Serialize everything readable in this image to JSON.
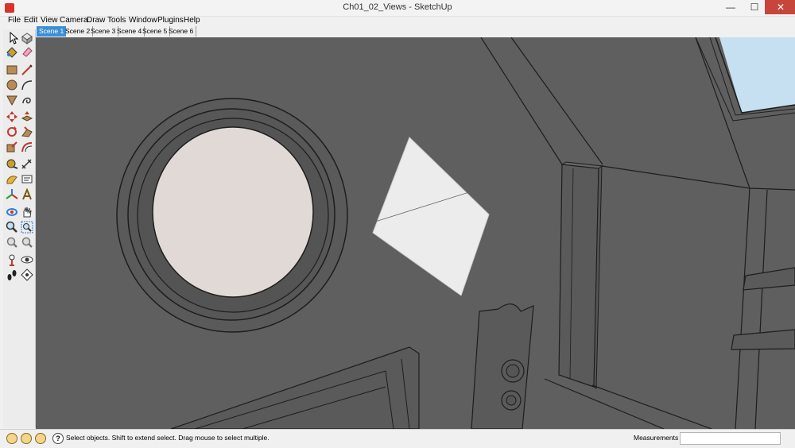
{
  "window": {
    "title": "Ch01_02_Views - SketchUp",
    "minimize": "—",
    "maximize": "☐",
    "close": "✕"
  },
  "menu": [
    "File",
    "Edit",
    "View",
    "Camera",
    "Draw",
    "Tools",
    "Window",
    "Plugins",
    "Help"
  ],
  "scenes": {
    "tabs": [
      "Scene 1",
      "Scene 2",
      "Scene 3",
      "Scene 4",
      "Scene 5",
      "Scene 6"
    ],
    "active": "Scene 1"
  },
  "tools": [
    "select-tool-icon",
    "make-component-icon",
    "paint-bucket-icon",
    "eraser-icon",
    "rectangle-icon",
    "line-icon",
    "circle-icon",
    "arc-icon",
    "polygon-icon",
    "freehand-icon",
    "move-icon",
    "push-pull-icon",
    "rotate-icon",
    "follow-me-icon",
    "scale-icon",
    "offset-icon",
    "tape-measure-icon",
    "dimension-icon",
    "protractor-icon",
    "text-icon",
    "axes-icon",
    "3d-text-icon",
    "orbit-icon",
    "pan-icon",
    "zoom-icon",
    "zoom-window-icon",
    "zoom-extents-icon",
    "previous-view-icon",
    "position-camera-icon",
    "look-around-icon",
    "walk-icon",
    "section-plane-icon"
  ],
  "status": {
    "message": "Select objects. Shift to extend select. Drag mouse to select multiple.",
    "measurements_label": "Measurements",
    "measurements_value": ""
  },
  "colors": {
    "wall": "#5f5f5f",
    "window_glass": "#e1d9d5",
    "highlight_plane": "#ececec",
    "sky": "#b9d6ef",
    "active_tab": "#3c8fd6"
  }
}
